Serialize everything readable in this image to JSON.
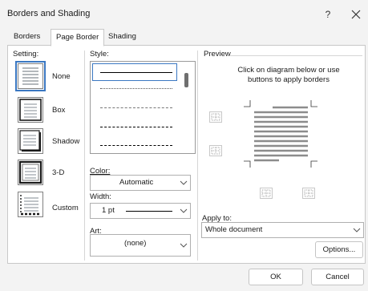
{
  "window": {
    "title": "Borders and Shading",
    "help_label": "?"
  },
  "tabs": [
    {
      "label": "Borders"
    },
    {
      "label": "Page Border",
      "active": true
    },
    {
      "label": "Shading"
    }
  ],
  "setting": {
    "heading": "Setting:",
    "options": [
      {
        "label": "None",
        "selected": true
      },
      {
        "label": "Box"
      },
      {
        "label": "Shadow"
      },
      {
        "label": "3-D"
      },
      {
        "label": "Custom"
      }
    ]
  },
  "style": {
    "heading": "Style:",
    "lines": [
      "solid",
      "dotted",
      "dashed-fine",
      "dashed",
      "dash-dot"
    ]
  },
  "color": {
    "label": "Color:",
    "value": "Automatic"
  },
  "width": {
    "label": "Width:",
    "value": "1 pt"
  },
  "art": {
    "label": "Art:",
    "value": "(none)"
  },
  "preview": {
    "heading": "Preview",
    "instruction": "Click on diagram below or use buttons to apply borders"
  },
  "apply_to": {
    "label": "Apply to:",
    "value": "Whole document"
  },
  "buttons": {
    "options": "Options...",
    "ok": "OK",
    "cancel": "Cancel"
  },
  "colors": {
    "accent": "#3b78c2",
    "panel": "#ffffff",
    "chrome": "#f3f3f3"
  }
}
